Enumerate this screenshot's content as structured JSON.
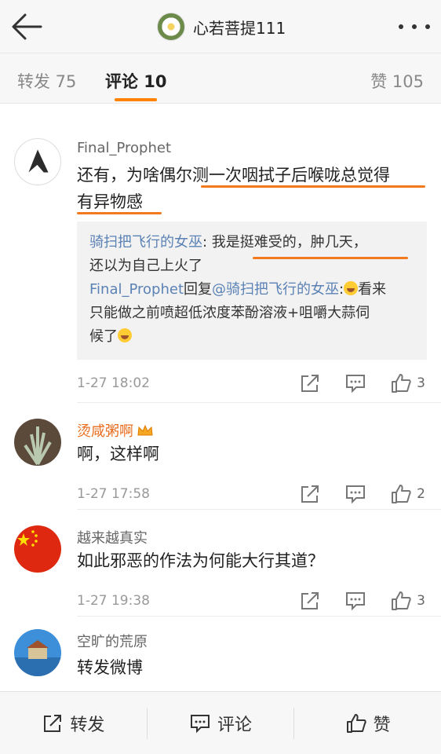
{
  "header": {
    "title": "心若菩提111",
    "back_icon": "arrow-left-icon",
    "more_icon": "more-dots-icon"
  },
  "tabs": {
    "repost": "转发 75",
    "comments": "评论 10",
    "likes": "赞 105"
  },
  "comments": [
    {
      "user": "Final_Prophet",
      "text_line1": "还有，为啥偶尔测一次咽拭子后喉咙总觉得",
      "text_line2": "有异物感",
      "replies": {
        "r1_user": "骑扫把飞行的女巫",
        "r1_text_a": ": 我是挺难受的，肿几天，",
        "r1_text_b": "还以为自己上火了",
        "r2_user": "Final_Prophet",
        "r2_mid": "回复",
        "r2_target": "@骑扫把飞行的女巫",
        "r2_text_a": ":",
        "r2_text_b": "看来",
        "r2_text_c": "只能做之前喷超低浓度苯酚溶液+咀嚼大蒜伺",
        "r2_text_d": "候了"
      },
      "time": "1-27 18:02",
      "likes": "3"
    },
    {
      "user": "烫咸粥啊",
      "text": "啊，这样啊",
      "time": "1-27 17:58",
      "likes": "2"
    },
    {
      "user": "越来越真实",
      "text": "如此邪恶的作法为何能大行其道？",
      "time": "1-27 19:38",
      "likes": "3"
    },
    {
      "user": "空旷的荒原",
      "text": "转发微博"
    }
  ],
  "bottom": {
    "repost": "转发",
    "comment": "评论",
    "like": "赞"
  },
  "colors": {
    "accent": "#ff8200",
    "link": "#5b82b5",
    "vip_name": "#e86d1f"
  }
}
